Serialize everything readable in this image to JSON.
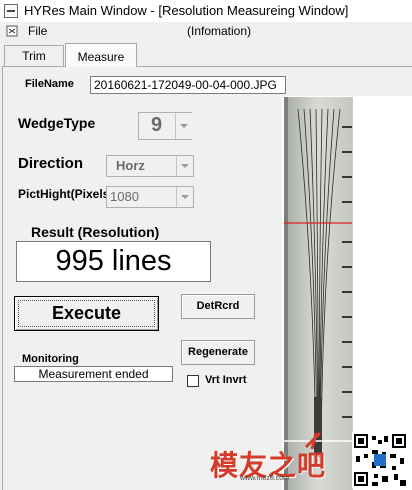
{
  "window": {
    "title": "HYRes Main Window - [Resolution Measureing Window]"
  },
  "menu": {
    "file_label": "File",
    "info_label": "(Infomation)"
  },
  "tabs": [
    {
      "label": "Trim",
      "active": false
    },
    {
      "label": "Measure",
      "active": true
    }
  ],
  "form": {
    "filename_label": "FileName",
    "filename_value": "20160621-172049-00-04-000.JPG",
    "wedge_type_label": "WedgeType",
    "wedge_type_value": "9",
    "direction_label": "Direction",
    "direction_value": "Horz",
    "pict_height_label": "PictHight(Pixels)",
    "pict_height_value": "1080",
    "result_label": "Result (Resolution)",
    "result_value": "995 lines",
    "execute_label": "Execute",
    "detrcrd_label": "DetRcrd",
    "regenerate_label": "Regenerate",
    "monitoring_label": "Monitoring",
    "monitoring_value": "Measurement ended",
    "vrt_invrt_label": "Vrt Invrt",
    "vrt_invrt_checked": false
  },
  "watermark": {
    "text": "模友之吧",
    "url": "www.moz8.com"
  },
  "colors": {
    "accent_red": "#d33c2a",
    "measure_line": "#e02020"
  }
}
